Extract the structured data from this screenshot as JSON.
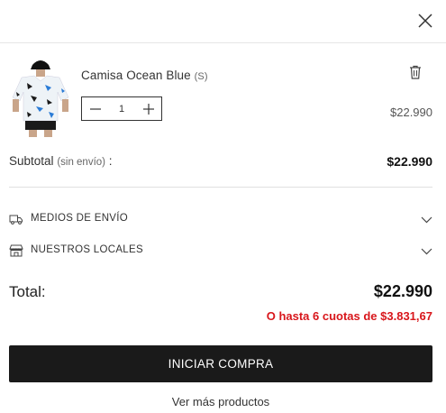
{
  "cart": {
    "close_icon": "close-icon",
    "item": {
      "name": "Camisa Ocean Blue",
      "variant": "(S)",
      "quantity": "1",
      "price": "$22.990",
      "trash_icon": "trash-icon"
    },
    "subtotal": {
      "label": "Subtotal",
      "note": "(sin envío)",
      "colon": " :",
      "value": "$22.990"
    },
    "accordions": [
      {
        "label": "MEDIOS DE ENVÍO",
        "icon": "truck-icon"
      },
      {
        "label": "NUESTROS LOCALES",
        "icon": "store-icon"
      }
    ],
    "total": {
      "label": "Total:",
      "value": "$22.990",
      "installments": "O hasta 6 cuotas de $3.831,67",
      "installments_color": "#d8161b"
    },
    "checkout_label": "INICIAR COMPRA",
    "more_products_label": "Ver más productos"
  }
}
